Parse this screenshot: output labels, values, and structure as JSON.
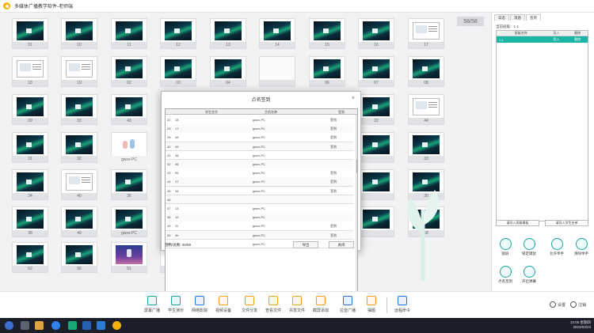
{
  "window": {
    "title": "多媒体广播教学软件-老师端"
  },
  "counter": "58/58",
  "thumbnails": [
    {
      "label": "01",
      "kind": "aurora"
    },
    {
      "label": "10",
      "kind": "aurora"
    },
    {
      "label": "11",
      "kind": "aurora"
    },
    {
      "label": "12",
      "kind": "aurora"
    },
    {
      "label": "13",
      "kind": "aurora"
    },
    {
      "label": "14",
      "kind": "aurora"
    },
    {
      "label": "15",
      "kind": "aurora"
    },
    {
      "label": "16",
      "kind": "aurora"
    },
    {
      "label": "17",
      "kind": "doc"
    },
    {
      "label": "18",
      "kind": "doc"
    },
    {
      "label": "19",
      "kind": "doc"
    },
    {
      "label": "02",
      "kind": "aurora"
    },
    {
      "label": "03",
      "kind": "aurora"
    },
    {
      "label": "04",
      "kind": "aurora"
    },
    {
      "label": "",
      "kind": "blank"
    },
    {
      "label": "06",
      "kind": "aurora"
    },
    {
      "label": "07",
      "kind": "aurora"
    },
    {
      "label": "08",
      "kind": "aurora"
    },
    {
      "label": "09",
      "kind": "aurora"
    },
    {
      "label": "33",
      "kind": "aurora"
    },
    {
      "label": "43",
      "kind": "aurora"
    },
    {
      "label": "",
      "kind": "none"
    },
    {
      "label": "",
      "kind": "none"
    },
    {
      "label": "",
      "kind": "none"
    },
    {
      "label": "",
      "kind": "none"
    },
    {
      "label": "22",
      "kind": "aurora"
    },
    {
      "label": "44",
      "kind": "doc"
    },
    {
      "label": "31",
      "kind": "aurora"
    },
    {
      "label": "32",
      "kind": "aurora"
    },
    {
      "label": "",
      "kind": "gpc"
    },
    {
      "label": "",
      "kind": "none"
    },
    {
      "label": "",
      "kind": "none"
    },
    {
      "label": "",
      "kind": "none"
    },
    {
      "label": "",
      "kind": "none"
    },
    {
      "label": "",
      "kind": "aurora"
    },
    {
      "label": "33",
      "kind": "aurora"
    },
    {
      "label": "34",
      "kind": "aurora"
    },
    {
      "label": "40",
      "kind": "doc"
    },
    {
      "label": "36",
      "kind": "aurora"
    },
    {
      "label": "",
      "kind": "none"
    },
    {
      "label": "",
      "kind": "none"
    },
    {
      "label": "",
      "kind": "none"
    },
    {
      "label": "",
      "kind": "none"
    },
    {
      "label": "",
      "kind": "aurora"
    },
    {
      "label": "30",
      "kind": "aurora"
    },
    {
      "label": "38",
      "kind": "aurora"
    },
    {
      "label": "49",
      "kind": "aurora"
    },
    {
      "label": "gwxx-PC",
      "kind": "aurora"
    },
    {
      "label": "",
      "kind": "none"
    },
    {
      "label": "",
      "kind": "none"
    },
    {
      "label": "",
      "kind": "none"
    },
    {
      "label": "",
      "kind": "none"
    },
    {
      "label": "",
      "kind": "aurora"
    },
    {
      "label": "58",
      "kind": "aurora"
    },
    {
      "label": "52",
      "kind": "aurora"
    },
    {
      "label": "56",
      "kind": "aurora"
    },
    {
      "label": "51",
      "kind": "space"
    },
    {
      "label": "54",
      "kind": "dark"
    }
  ],
  "gpc_label": "gwxx-PC",
  "modal": {
    "title": "点名签到",
    "close": "×",
    "columns": [
      "学生名字",
      "主机名称",
      "签到"
    ],
    "rows": [
      {
        "no": "22",
        "name": "18",
        "host": "gwxx-PC",
        "sign": "签到"
      },
      {
        "no": "25",
        "name": "17",
        "host": "gwxx-PC",
        "sign": "签到"
      },
      {
        "no": "26",
        "name": "26",
        "host": "gwxx-PC",
        "sign": "签到"
      },
      {
        "no": "40",
        "name": "49",
        "host": "gwxx-PC",
        "sign": "签到"
      },
      {
        "no": "41",
        "name": "38",
        "host": "gwxx-PC",
        "sign": ""
      },
      {
        "no": "42",
        "name": "36",
        "host": "gwxx-PC",
        "sign": ""
      },
      {
        "no": "43",
        "name": "59",
        "host": "gwxx-PC",
        "sign": "签到"
      },
      {
        "no": "44",
        "name": "37",
        "host": "gwxx-PC",
        "sign": "签到"
      },
      {
        "no": "45",
        "name": "34",
        "host": "gwxx-PC",
        "sign": "签到"
      },
      {
        "no": "46",
        "name": "",
        "host": "",
        "sign": ""
      },
      {
        "no": "47",
        "name": "13",
        "host": "gwxx-PC",
        "sign": ""
      },
      {
        "no": "48",
        "name": "12",
        "host": "gwxx-PC",
        "sign": ""
      },
      {
        "no": "49",
        "name": "11",
        "host": "gwxx-PC",
        "sign": "签到"
      },
      {
        "no": "50",
        "name": "4b",
        "host": "gwxx-PC",
        "sign": "签到"
      },
      {
        "no": "51",
        "name": "",
        "host": "gwxx-PC",
        "sign": ""
      }
    ],
    "footer_count": "签到/总数: 45/58",
    "export_btn": "导出",
    "close_btn": "关闭"
  },
  "right_panel": {
    "tabs": [
      "日志",
      "消息",
      "签到"
    ],
    "current_class": "当前班级：1-1",
    "columns": [
      "班级名称",
      "导入",
      "删除"
    ],
    "row": {
      "name": "1-1",
      "import": "导入",
      "delete": "删除"
    },
    "btn_left": "请导入班级模板",
    "btn_right": "请导入学生名单",
    "actions": [
      {
        "label": "锁屏",
        "icon": "lock-icon"
      },
      {
        "label": "锁定键鼠",
        "icon": "keyboard-mouse-icon"
      },
      {
        "label": "允许举手",
        "icon": "hand-icon"
      },
      {
        "label": "清除举手",
        "icon": "hand-clear-icon"
      },
      {
        "label": "点名签到",
        "icon": "roll-call-icon"
      },
      {
        "label": "开启弹幕",
        "icon": "barrage-icon"
      }
    ]
  },
  "toolbar": {
    "items": [
      {
        "label": "屏幕广播",
        "icon": "screen-broadcast-icon",
        "color": "teal"
      },
      {
        "label": "学生演示",
        "icon": "student-demo-icon",
        "color": "teal"
      },
      {
        "label": "网络影院",
        "icon": "network-cinema-icon",
        "color": "blue"
      },
      {
        "label": "视频设备",
        "icon": "video-device-icon",
        "color": "orange"
      },
      {
        "label": "文件分发",
        "icon": "file-distribute-icon",
        "color": "orange"
      },
      {
        "label": "查看文件",
        "icon": "view-file-icon",
        "color": "orange"
      },
      {
        "label": "共享文件",
        "icon": "share-file-icon",
        "color": "orange"
      },
      {
        "label": "截屏添加",
        "icon": "screenshot-icon",
        "color": "orange"
      },
      {
        "label": "拉音广播",
        "icon": "alarm-icon",
        "color": "blue"
      },
      {
        "label": "抽题",
        "icon": "quiz-icon",
        "color": "orange"
      },
      {
        "label": "远程命令",
        "icon": "remote-command-icon",
        "color": "blue"
      }
    ],
    "settings": "设置",
    "logout": "注销"
  },
  "clock": {
    "time": "10:05 星期四",
    "date": "2023/03/23"
  }
}
